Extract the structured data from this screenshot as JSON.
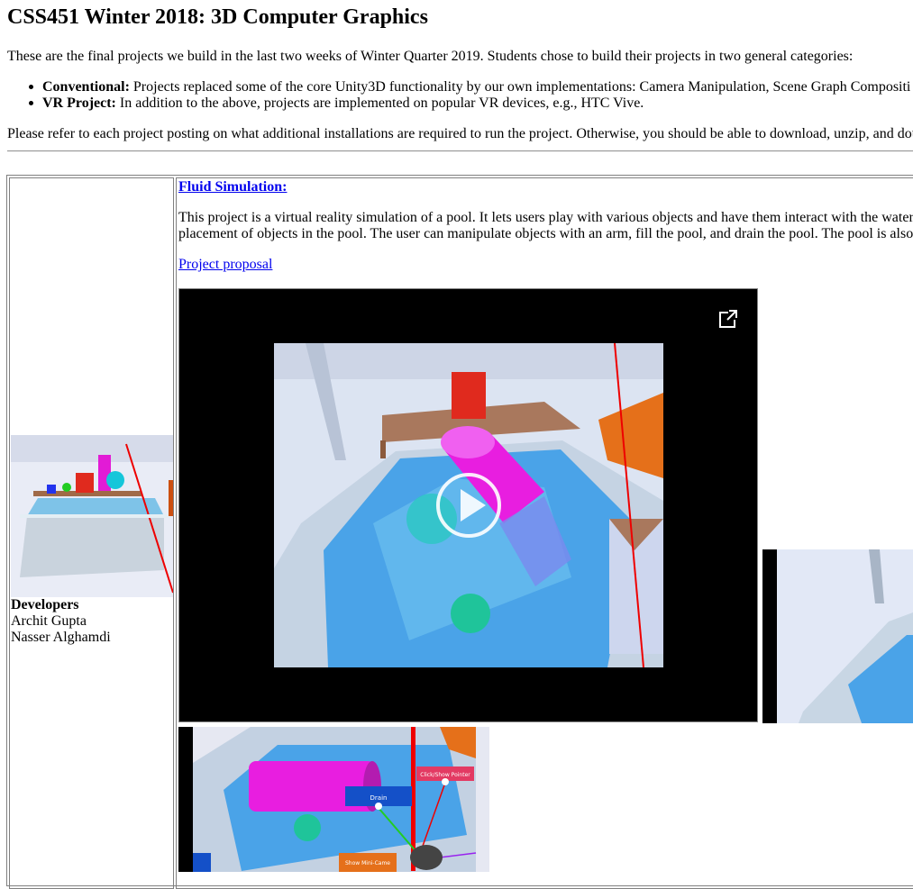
{
  "page": {
    "title": "CSS451 Winter 2018: 3D Computer Graphics",
    "intro": "These are the final projects we build in the last two weeks of Winter Quarter 2019. Students chose to build their projects in two general categories:",
    "categories": [
      {
        "label": "Conventional:",
        "text": "Projects replaced some of the core Unity3D functionality by our own implementations: Camera Manipulation, Scene Graph Compositi"
      },
      {
        "label": "VR Project:",
        "text": "In addition to the above, projects are implemented on popular VR devices, e.g., HTC Vive."
      }
    ],
    "note": "Please refer to each project posting on what additional installations are required to run the project. Otherwise, you should be able to download, unzip, and dou"
  },
  "project": {
    "title": "Fluid Simulation:",
    "desc_line1": "This project is a virtual reality simulation of a pool. It lets users play with various objects and have them interact with the water",
    "desc_line2": "placement of objects in the pool. The user can manipulate objects with an arm, fill the pool, and drain the pool. The pool is also",
    "proposal_link": "Project proposal",
    "developers_label": "Developers",
    "developers": [
      "Archit Gupta",
      "Nasser Alghamdi"
    ],
    "video_overlay_labels": {
      "drain": "Drain",
      "pointer": "Click/Show Pointer",
      "minicam": "Show Mini-Came"
    }
  },
  "colors": {
    "link": "#0000ee",
    "video_bg": "#000000",
    "water": "#4aa3e8",
    "magenta": "#e81ee0"
  },
  "icons": {
    "external": "open-in-new-icon",
    "play": "play-icon"
  }
}
